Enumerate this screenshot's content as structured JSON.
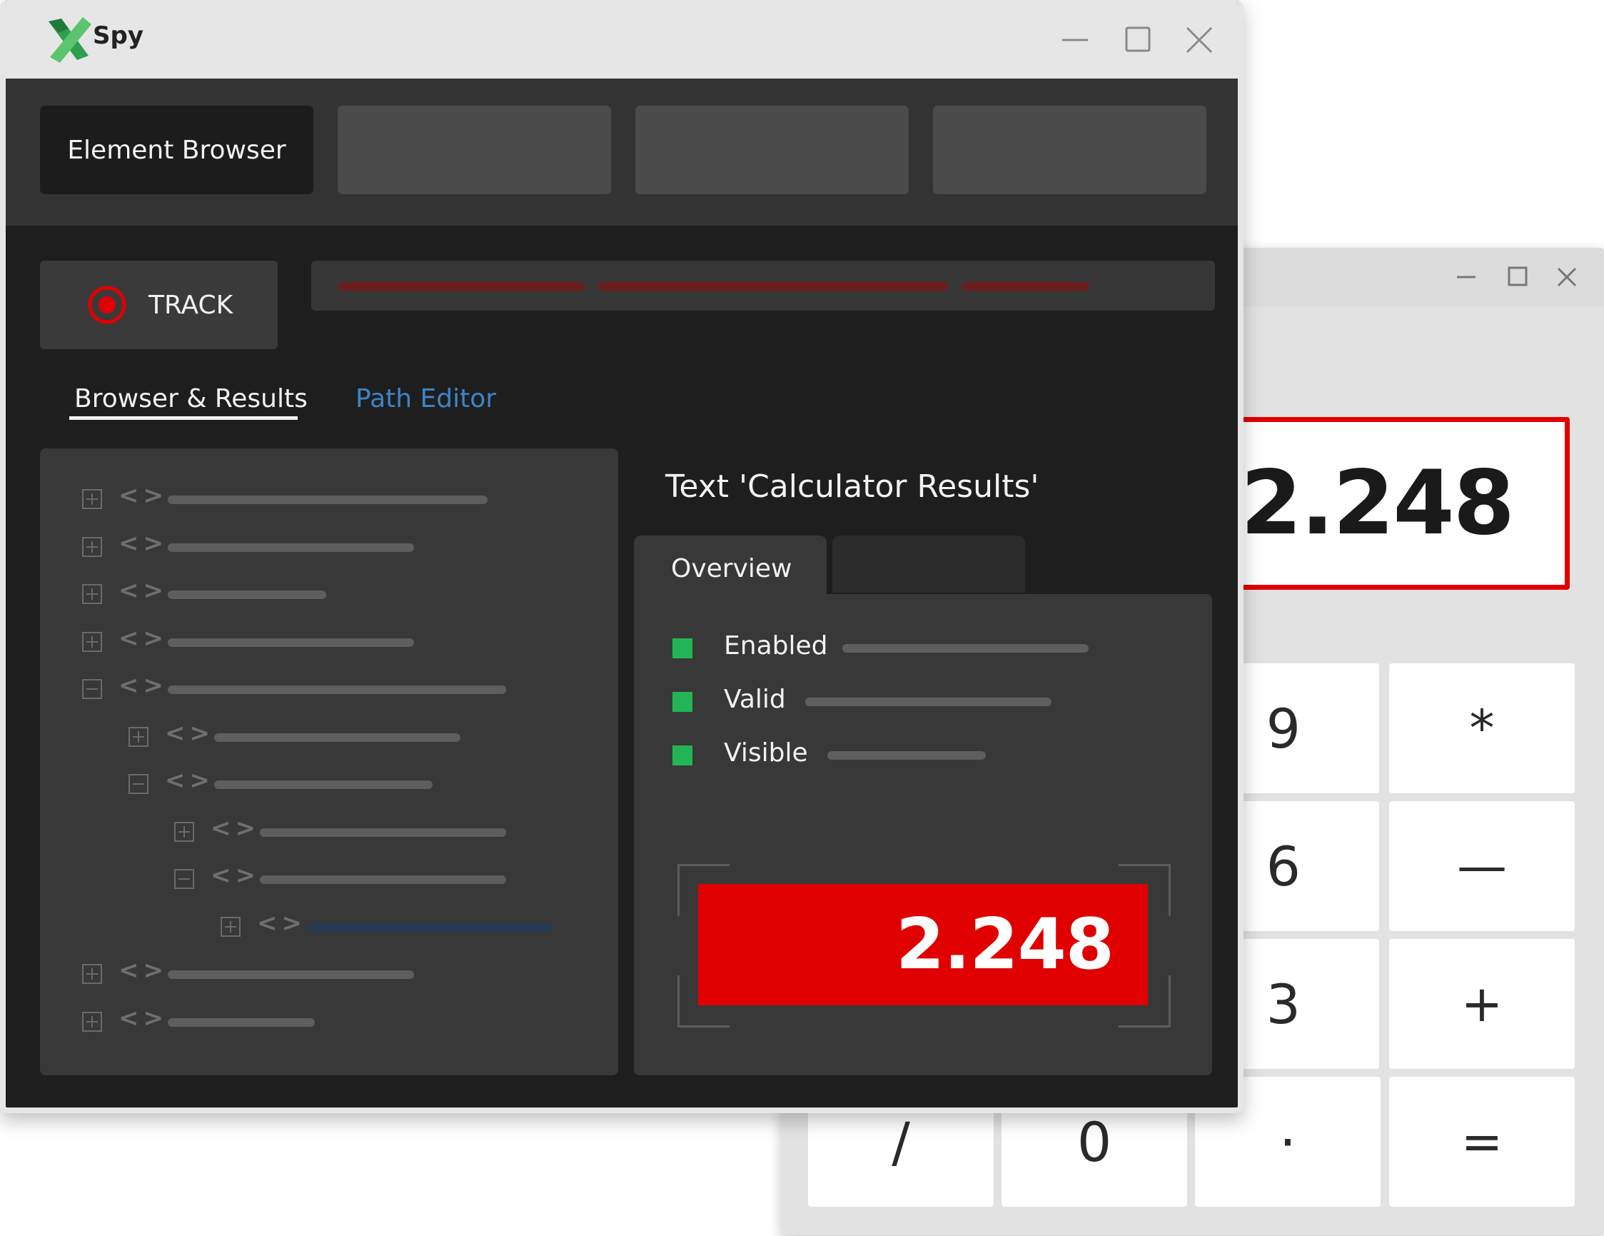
{
  "app": {
    "title": "Spy"
  },
  "toolbar": {
    "active_tab": "Element Browser"
  },
  "track": {
    "label": "TRACK"
  },
  "tabs": {
    "browser_results": "Browser & Results",
    "path_editor": "Path Editor"
  },
  "details": {
    "title": "Text 'Calculator Results'",
    "overview_tab": "Overview",
    "properties": [
      {
        "label": "Enabled",
        "status_color": "#22b556"
      },
      {
        "label": "Valid",
        "status_color": "#22b556"
      },
      {
        "label": "Visible",
        "status_color": "#22b556"
      }
    ],
    "result_value": "2.248"
  },
  "calculator": {
    "display": "2.248",
    "keys": [
      "9",
      "*",
      "6",
      "—",
      "3",
      "+",
      "/",
      "0",
      "·",
      "="
    ]
  },
  "colors": {
    "accent_red": "#e00000",
    "link_blue": "#3d84c8",
    "status_green": "#22b556",
    "logo_green": "#2e9e4f"
  },
  "icons": [
    "spy-logo-icon",
    "minimize-icon",
    "maximize-icon",
    "close-icon",
    "record-target-icon",
    "expand-plus-icon",
    "collapse-minus-icon",
    "code-tag-icon"
  ]
}
